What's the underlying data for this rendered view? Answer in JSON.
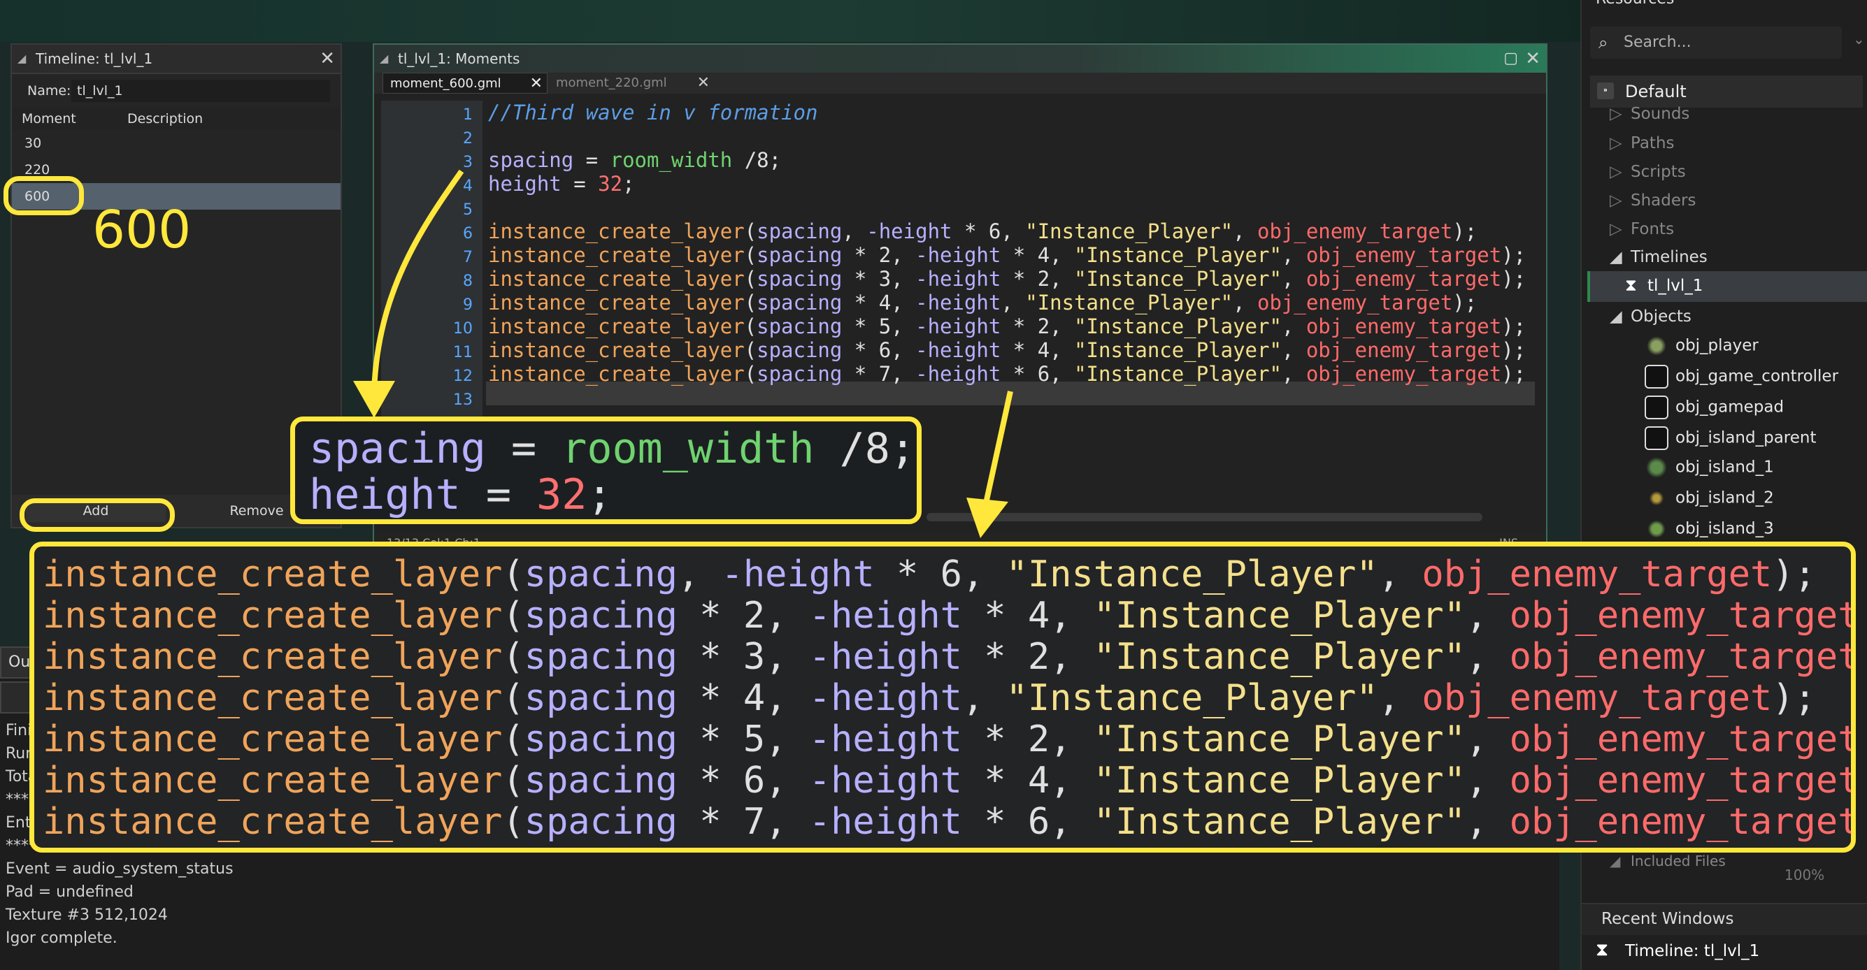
{
  "colors": {
    "accent": "#ffe83b",
    "selection": "#55616c",
    "line_number": "#5aa7ff"
  },
  "resources": {
    "header": "Resources",
    "search_placeholder": "Search...",
    "default_label": "Default",
    "sounds": "Sounds",
    "paths": "Paths",
    "scripts": "Scripts",
    "shaders": "Shaders",
    "fonts": "Fonts",
    "timelines": "Timelines",
    "timeline_item": "tl_lvl_1",
    "objects": "Objects",
    "object_items": [
      "obj_player",
      "obj_game_controller",
      "obj_gamepad",
      "obj_island_parent",
      "obj_island_1",
      "obj_island_2",
      "obj_island_3"
    ],
    "included_files": "Included Files",
    "zoom": "100%",
    "recent_title": "Recent Windows",
    "recent_item": "Timeline: tl_lvl_1"
  },
  "timeline": {
    "title": "Timeline: tl_lvl_1",
    "name_label": "Name:",
    "name_value": "tl_lvl_1",
    "col_moment": "Moment",
    "col_description": "Description",
    "moments": [
      "30",
      "220",
      "600"
    ],
    "add_label": "Add",
    "remove_label": "Remove"
  },
  "annotation_600": "600",
  "editor": {
    "title": "tl_lvl_1: Moments",
    "tabs": [
      "moment_600.gml",
      "moment_220.gml"
    ],
    "line_numbers": [
      "1",
      "2",
      "3",
      "4",
      "5",
      "6",
      "7",
      "8",
      "9",
      "10",
      "11",
      "12",
      "13"
    ],
    "comment": "//Third wave in v formation",
    "status_left": "13/13 Col:1 Ch:1",
    "status_right": "INS"
  },
  "code": {
    "spacing": "spacing",
    "height": "height",
    "fn": "instance_create_layer",
    "room_width": "room_width",
    "div8": "/8",
    "num32": "32",
    "layer": "\"Instance_Player\"",
    "obj": "obj_enemy_target",
    "rows": [
      {
        "mul": "",
        "neg": "-height",
        "hmul": " * 6"
      },
      {
        "mul": " * 2",
        "neg": "-height",
        "hmul": " * 4"
      },
      {
        "mul": " * 3",
        "neg": "-height",
        "hmul": " * 2"
      },
      {
        "mul": " * 4",
        "neg": "-height",
        "hmul": ""
      },
      {
        "mul": " * 5",
        "neg": "-height",
        "hmul": " * 2"
      },
      {
        "mul": " * 6",
        "neg": "-height",
        "hmul": " * 4"
      },
      {
        "mul": " * 7",
        "neg": "-height",
        "hmul": " * 6"
      }
    ]
  },
  "output": {
    "tab_label": "Output",
    "lines": [
      "Finis",
      "Runn",
      "Tota",
      "****",
      "Ente",
      "**********************************",
      "Event = audio_system_status",
      "Pad = undefined",
      "Texture #3 512,1024",
      "Igor complete."
    ]
  }
}
